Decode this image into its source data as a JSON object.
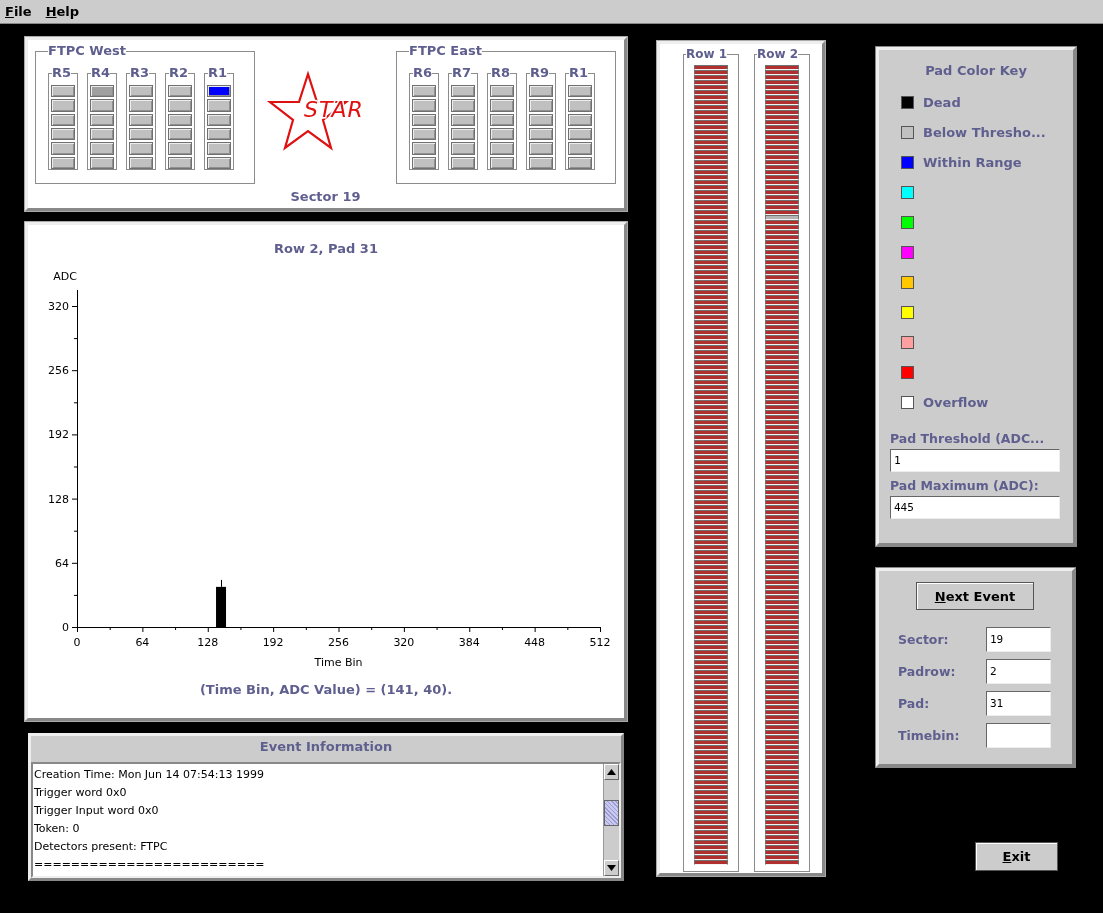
{
  "menu": [
    {
      "label": "File"
    },
    {
      "label": "Help"
    }
  ],
  "sector_panel": {
    "groups": [
      {
        "title": "FTPC West",
        "rafters": [
          {
            "label": "R5",
            "pads": [
              {
                "color": "#c0c0c0"
              },
              {
                "color": "#c0c0c0"
              },
              {
                "color": "#c0c0c0"
              },
              {
                "color": "#c0c0c0"
              },
              {
                "color": "#c0c0c0"
              },
              {
                "color": "#c0c0c0"
              }
            ]
          },
          {
            "label": "R4",
            "pads": [
              {
                "color": "#a0a0a0"
              },
              {
                "color": "#c0c0c0"
              },
              {
                "color": "#c0c0c0"
              },
              {
                "color": "#c0c0c0"
              },
              {
                "color": "#c0c0c0"
              },
              {
                "color": "#c0c0c0"
              }
            ]
          },
          {
            "label": "R3",
            "pads": [
              {
                "color": "#c0c0c0"
              },
              {
                "color": "#c0c0c0"
              },
              {
                "color": "#c0c0c0"
              },
              {
                "color": "#c0c0c0"
              },
              {
                "color": "#c0c0c0"
              },
              {
                "color": "#c0c0c0"
              }
            ]
          },
          {
            "label": "R2",
            "pads": [
              {
                "color": "#c0c0c0"
              },
              {
                "color": "#c0c0c0"
              },
              {
                "color": "#c0c0c0"
              },
              {
                "color": "#c0c0c0"
              },
              {
                "color": "#c0c0c0"
              },
              {
                "color": "#c0c0c0"
              }
            ]
          },
          {
            "label": "R1",
            "pads": [
              {
                "color": "#0000ff"
              },
              {
                "color": "#c0c0c0"
              },
              {
                "color": "#c0c0c0"
              },
              {
                "color": "#c0c0c0"
              },
              {
                "color": "#c0c0c0"
              },
              {
                "color": "#c0c0c0"
              }
            ]
          }
        ]
      },
      {
        "title": "FTPC East",
        "rafters": [
          {
            "label": "R6",
            "pads": [
              {
                "color": "#c0c0c0"
              },
              {
                "color": "#c0c0c0"
              },
              {
                "color": "#c0c0c0"
              },
              {
                "color": "#c0c0c0"
              },
              {
                "color": "#c0c0c0"
              },
              {
                "color": "#c0c0c0"
              }
            ]
          },
          {
            "label": "R7",
            "pads": [
              {
                "color": "#c0c0c0"
              },
              {
                "color": "#c0c0c0"
              },
              {
                "color": "#c0c0c0"
              },
              {
                "color": "#c0c0c0"
              },
              {
                "color": "#c0c0c0"
              },
              {
                "color": "#c0c0c0"
              }
            ]
          },
          {
            "label": "R8",
            "pads": [
              {
                "color": "#c0c0c0"
              },
              {
                "color": "#c0c0c0"
              },
              {
                "color": "#c0c0c0"
              },
              {
                "color": "#c0c0c0"
              },
              {
                "color": "#c0c0c0"
              },
              {
                "color": "#c0c0c0"
              }
            ]
          },
          {
            "label": "R9",
            "pads": [
              {
                "color": "#c0c0c0"
              },
              {
                "color": "#c0c0c0"
              },
              {
                "color": "#c0c0c0"
              },
              {
                "color": "#c0c0c0"
              },
              {
                "color": "#c0c0c0"
              },
              {
                "color": "#c0c0c0"
              }
            ]
          },
          {
            "label": "R1",
            "pads": [
              {
                "color": "#c0c0c0"
              },
              {
                "color": "#c0c0c0"
              },
              {
                "color": "#c0c0c0"
              },
              {
                "color": "#c0c0c0"
              },
              {
                "color": "#c0c0c0"
              },
              {
                "color": "#c0c0c0"
              }
            ]
          }
        ]
      }
    ],
    "logo_text": "STAR",
    "caption": "Sector 19"
  },
  "chart_panel": {
    "readout": "(Time Bin, ADC Value) = (141, 40).",
    "chart_data": {
      "type": "bar",
      "title": "Row 2, Pad 31",
      "xlabel": "Time Bin",
      "ylabel": "ADC",
      "x": [
        141
      ],
      "values": [
        40
      ],
      "xlim": [
        0,
        512
      ],
      "ylim": [
        0,
        336
      ],
      "xticks": [
        0,
        64,
        128,
        192,
        256,
        320,
        384,
        448,
        512
      ],
      "yticks": [
        0,
        64,
        128,
        192,
        256,
        320
      ]
    }
  },
  "event_info": {
    "title": "Event Information",
    "lines": [
      "Creation Time: Mon Jun 14 07:54:13 1999",
      "Trigger word 0x0",
      "Trigger Input word 0x0",
      "Token: 0",
      "Detectors present: FTPC",
      "========================="
    ]
  },
  "rows": [
    {
      "label": "Row 1",
      "pads": [
        {
          "color": "#b03030"
        },
        {
          "color": "#b03030"
        },
        {
          "color": "#b03030"
        },
        {
          "color": "#b03030"
        },
        {
          "color": "#b03030"
        },
        {
          "color": "#b03030"
        },
        {
          "color": "#b03030"
        },
        {
          "color": "#b03030"
        },
        {
          "color": "#b03030"
        },
        {
          "color": "#b03030"
        },
        {
          "color": "#b03030"
        },
        {
          "color": "#b03030"
        },
        {
          "color": "#b03030"
        },
        {
          "color": "#b03030"
        },
        {
          "color": "#b03030"
        },
        {
          "color": "#b03030"
        },
        {
          "color": "#b03030"
        },
        {
          "color": "#b03030"
        },
        {
          "color": "#b03030"
        },
        {
          "color": "#b03030"
        },
        {
          "color": "#b03030"
        },
        {
          "color": "#b03030"
        },
        {
          "color": "#b03030"
        },
        {
          "color": "#b03030"
        },
        {
          "color": "#b03030"
        },
        {
          "color": "#b03030"
        },
        {
          "color": "#b03030"
        },
        {
          "color": "#b03030"
        },
        {
          "color": "#b03030"
        },
        {
          "color": "#b03030"
        },
        {
          "color": "#b03030"
        },
        {
          "color": "#b03030"
        },
        {
          "color": "#b03030"
        },
        {
          "color": "#b03030"
        },
        {
          "color": "#b03030"
        },
        {
          "color": "#b03030"
        },
        {
          "color": "#b03030"
        },
        {
          "color": "#b03030"
        },
        {
          "color": "#b03030"
        },
        {
          "color": "#b03030"
        },
        {
          "color": "#b03030"
        },
        {
          "color": "#b03030"
        },
        {
          "color": "#b03030"
        },
        {
          "color": "#b03030"
        },
        {
          "color": "#b03030"
        },
        {
          "color": "#b03030"
        },
        {
          "color": "#b03030"
        },
        {
          "color": "#b03030"
        },
        {
          "color": "#b03030"
        },
        {
          "color": "#b03030"
        },
        {
          "color": "#b03030"
        },
        {
          "color": "#b03030"
        },
        {
          "color": "#b03030"
        },
        {
          "color": "#b03030"
        },
        {
          "color": "#b03030"
        },
        {
          "color": "#b03030"
        },
        {
          "color": "#b03030"
        },
        {
          "color": "#b03030"
        },
        {
          "color": "#b03030"
        },
        {
          "color": "#b03030"
        },
        {
          "color": "#b03030"
        },
        {
          "color": "#b03030"
        },
        {
          "color": "#b03030"
        },
        {
          "color": "#b03030"
        },
        {
          "color": "#b03030"
        },
        {
          "color": "#b03030"
        },
        {
          "color": "#b03030"
        },
        {
          "color": "#b03030"
        },
        {
          "color": "#b03030"
        },
        {
          "color": "#b03030"
        },
        {
          "color": "#b03030"
        },
        {
          "color": "#b03030"
        },
        {
          "color": "#b03030"
        },
        {
          "color": "#b03030"
        },
        {
          "color": "#b03030"
        },
        {
          "color": "#b03030"
        },
        {
          "color": "#b03030"
        },
        {
          "color": "#b03030"
        },
        {
          "color": "#b03030"
        },
        {
          "color": "#b03030"
        },
        {
          "color": "#b03030"
        },
        {
          "color": "#b03030"
        },
        {
          "color": "#b03030"
        },
        {
          "color": "#b03030"
        },
        {
          "color": "#b03030"
        },
        {
          "color": "#b03030"
        },
        {
          "color": "#b03030"
        },
        {
          "color": "#b03030"
        },
        {
          "color": "#b03030"
        },
        {
          "color": "#b03030"
        },
        {
          "color": "#b03030"
        },
        {
          "color": "#b03030"
        },
        {
          "color": "#b03030"
        },
        {
          "color": "#b03030"
        },
        {
          "color": "#b03030"
        },
        {
          "color": "#b03030"
        },
        {
          "color": "#b03030"
        },
        {
          "color": "#b03030"
        },
        {
          "color": "#b03030"
        },
        {
          "color": "#b03030"
        },
        {
          "color": "#b03030"
        },
        {
          "color": "#b03030"
        },
        {
          "color": "#b03030"
        },
        {
          "color": "#b03030"
        },
        {
          "color": "#b03030"
        },
        {
          "color": "#b03030"
        },
        {
          "color": "#b03030"
        },
        {
          "color": "#b03030"
        },
        {
          "color": "#b03030"
        },
        {
          "color": "#b03030"
        },
        {
          "color": "#b03030"
        },
        {
          "color": "#b03030"
        },
        {
          "color": "#b03030"
        },
        {
          "color": "#b03030"
        },
        {
          "color": "#b03030"
        },
        {
          "color": "#b03030"
        },
        {
          "color": "#b03030"
        },
        {
          "color": "#b03030"
        },
        {
          "color": "#b03030"
        },
        {
          "color": "#b03030"
        },
        {
          "color": "#b03030"
        },
        {
          "color": "#b03030"
        },
        {
          "color": "#b03030"
        },
        {
          "color": "#b03030"
        },
        {
          "color": "#b03030"
        },
        {
          "color": "#b03030"
        },
        {
          "color": "#b03030"
        },
        {
          "color": "#b03030"
        },
        {
          "color": "#b03030"
        },
        {
          "color": "#b03030"
        },
        {
          "color": "#b03030"
        },
        {
          "color": "#b03030"
        },
        {
          "color": "#b03030"
        },
        {
          "color": "#b03030"
        },
        {
          "color": "#b03030"
        },
        {
          "color": "#b03030"
        },
        {
          "color": "#b03030"
        },
        {
          "color": "#b03030"
        },
        {
          "color": "#b03030"
        },
        {
          "color": "#b03030"
        },
        {
          "color": "#b03030"
        },
        {
          "color": "#b03030"
        },
        {
          "color": "#b03030"
        },
        {
          "color": "#b03030"
        },
        {
          "color": "#b03030"
        },
        {
          "color": "#b03030"
        },
        {
          "color": "#b03030"
        },
        {
          "color": "#b03030"
        },
        {
          "color": "#b03030"
        },
        {
          "color": "#b03030"
        },
        {
          "color": "#b03030"
        },
        {
          "color": "#b03030"
        },
        {
          "color": "#b03030"
        },
        {
          "color": "#b03030"
        },
        {
          "color": "#b03030"
        },
        {
          "color": "#b03030"
        },
        {
          "color": "#b03030"
        },
        {
          "color": "#b03030"
        },
        {
          "color": "#b03030"
        },
        {
          "color": "#b03030"
        }
      ]
    },
    {
      "label": "Row 2",
      "pads": [
        {
          "color": "#b03030"
        },
        {
          "color": "#b03030"
        },
        {
          "color": "#b03030"
        },
        {
          "color": "#b03030"
        },
        {
          "color": "#b03030"
        },
        {
          "color": "#b03030"
        },
        {
          "color": "#b03030"
        },
        {
          "color": "#b03030"
        },
        {
          "color": "#b03030"
        },
        {
          "color": "#b03030"
        },
        {
          "color": "#b03030"
        },
        {
          "color": "#b03030"
        },
        {
          "color": "#b03030"
        },
        {
          "color": "#b03030"
        },
        {
          "color": "#b03030"
        },
        {
          "color": "#b03030"
        },
        {
          "color": "#b03030"
        },
        {
          "color": "#b03030"
        },
        {
          "color": "#b03030"
        },
        {
          "color": "#b03030"
        },
        {
          "color": "#b03030"
        },
        {
          "color": "#b03030"
        },
        {
          "color": "#b03030"
        },
        {
          "color": "#b03030"
        },
        {
          "color": "#b03030"
        },
        {
          "color": "#b03030"
        },
        {
          "color": "#b03030"
        },
        {
          "color": "#b03030"
        },
        {
          "color": "#b03030"
        },
        {
          "color": "#b03030"
        },
        {
          "color": "#b4b4b4"
        },
        {
          "color": "#b03030"
        },
        {
          "color": "#b03030"
        },
        {
          "color": "#b03030"
        },
        {
          "color": "#b03030"
        },
        {
          "color": "#b03030"
        },
        {
          "color": "#b03030"
        },
        {
          "color": "#b03030"
        },
        {
          "color": "#b03030"
        },
        {
          "color": "#b03030"
        },
        {
          "color": "#b03030"
        },
        {
          "color": "#b03030"
        },
        {
          "color": "#b03030"
        },
        {
          "color": "#b03030"
        },
        {
          "color": "#b03030"
        },
        {
          "color": "#b03030"
        },
        {
          "color": "#b03030"
        },
        {
          "color": "#b03030"
        },
        {
          "color": "#b03030"
        },
        {
          "color": "#b03030"
        },
        {
          "color": "#b03030"
        },
        {
          "color": "#b03030"
        },
        {
          "color": "#b03030"
        },
        {
          "color": "#b03030"
        },
        {
          "color": "#b03030"
        },
        {
          "color": "#b03030"
        },
        {
          "color": "#b03030"
        },
        {
          "color": "#b03030"
        },
        {
          "color": "#b03030"
        },
        {
          "color": "#b03030"
        },
        {
          "color": "#b03030"
        },
        {
          "color": "#b03030"
        },
        {
          "color": "#b03030"
        },
        {
          "color": "#b03030"
        },
        {
          "color": "#b03030"
        },
        {
          "color": "#b03030"
        },
        {
          "color": "#b03030"
        },
        {
          "color": "#b03030"
        },
        {
          "color": "#b03030"
        },
        {
          "color": "#b03030"
        },
        {
          "color": "#b03030"
        },
        {
          "color": "#b03030"
        },
        {
          "color": "#b03030"
        },
        {
          "color": "#b03030"
        },
        {
          "color": "#b03030"
        },
        {
          "color": "#b03030"
        },
        {
          "color": "#b03030"
        },
        {
          "color": "#b03030"
        },
        {
          "color": "#b03030"
        },
        {
          "color": "#b03030"
        },
        {
          "color": "#b03030"
        },
        {
          "color": "#b03030"
        },
        {
          "color": "#b03030"
        },
        {
          "color": "#b03030"
        },
        {
          "color": "#b03030"
        },
        {
          "color": "#b03030"
        },
        {
          "color": "#b03030"
        },
        {
          "color": "#b03030"
        },
        {
          "color": "#b03030"
        },
        {
          "color": "#b03030"
        },
        {
          "color": "#b03030"
        },
        {
          "color": "#b03030"
        },
        {
          "color": "#b03030"
        },
        {
          "color": "#b03030"
        },
        {
          "color": "#b03030"
        },
        {
          "color": "#b03030"
        },
        {
          "color": "#b03030"
        },
        {
          "color": "#b03030"
        },
        {
          "color": "#b03030"
        },
        {
          "color": "#b03030"
        },
        {
          "color": "#b03030"
        },
        {
          "color": "#b03030"
        },
        {
          "color": "#b03030"
        },
        {
          "color": "#b03030"
        },
        {
          "color": "#b03030"
        },
        {
          "color": "#b03030"
        },
        {
          "color": "#b03030"
        },
        {
          "color": "#b03030"
        },
        {
          "color": "#b03030"
        },
        {
          "color": "#b03030"
        },
        {
          "color": "#b03030"
        },
        {
          "color": "#b03030"
        },
        {
          "color": "#b03030"
        },
        {
          "color": "#b03030"
        },
        {
          "color": "#b03030"
        },
        {
          "color": "#b03030"
        },
        {
          "color": "#b03030"
        },
        {
          "color": "#b03030"
        },
        {
          "color": "#b03030"
        },
        {
          "color": "#b03030"
        },
        {
          "color": "#b03030"
        },
        {
          "color": "#b03030"
        },
        {
          "color": "#b03030"
        },
        {
          "color": "#b03030"
        },
        {
          "color": "#b03030"
        },
        {
          "color": "#b03030"
        },
        {
          "color": "#b03030"
        },
        {
          "color": "#b03030"
        },
        {
          "color": "#b03030"
        },
        {
          "color": "#b03030"
        },
        {
          "color": "#b03030"
        },
        {
          "color": "#b03030"
        },
        {
          "color": "#b03030"
        },
        {
          "color": "#b03030"
        },
        {
          "color": "#b03030"
        },
        {
          "color": "#b03030"
        },
        {
          "color": "#b03030"
        },
        {
          "color": "#b03030"
        },
        {
          "color": "#b03030"
        },
        {
          "color": "#b03030"
        },
        {
          "color": "#b03030"
        },
        {
          "color": "#b03030"
        },
        {
          "color": "#b03030"
        },
        {
          "color": "#b03030"
        },
        {
          "color": "#b03030"
        },
        {
          "color": "#b03030"
        },
        {
          "color": "#b03030"
        },
        {
          "color": "#b03030"
        },
        {
          "color": "#b03030"
        },
        {
          "color": "#b03030"
        },
        {
          "color": "#b03030"
        },
        {
          "color": "#b03030"
        },
        {
          "color": "#b03030"
        },
        {
          "color": "#b03030"
        },
        {
          "color": "#b03030"
        },
        {
          "color": "#b03030"
        },
        {
          "color": "#b03030"
        },
        {
          "color": "#b03030"
        },
        {
          "color": "#b03030"
        },
        {
          "color": "#b03030"
        }
      ]
    }
  ],
  "color_key": {
    "title": "Pad Color Key",
    "items": [
      {
        "color": "#000000",
        "label": "Dead"
      },
      {
        "color": "#c0c0c0",
        "label": "Below Thresho..."
      },
      {
        "color": "#0000ff",
        "label": "Within Range"
      },
      {
        "color": "#00ffff"
      },
      {
        "color": "#00ff00"
      },
      {
        "color": "#ff00ff"
      },
      {
        "color": "#ffc800"
      },
      {
        "color": "#ffff00"
      },
      {
        "color": "#ffa0a0"
      },
      {
        "color": "#ff0000"
      },
      {
        "color": "#ffffff",
        "label": "Overflow"
      }
    ],
    "fields": [
      {
        "label": "Pad Threshold (ADC...",
        "value": "1"
      },
      {
        "label": "Pad Maximum (ADC):",
        "value": "445"
      }
    ]
  },
  "event_controls": {
    "next_button": "Next Event",
    "fields": [
      {
        "label": "Sector:",
        "value": "19"
      },
      {
        "label": "Padrow:",
        "value": "2"
      },
      {
        "label": "Pad:",
        "value": "31"
      },
      {
        "label": "Timebin:"
      }
    ]
  },
  "exit_button": "Exit"
}
